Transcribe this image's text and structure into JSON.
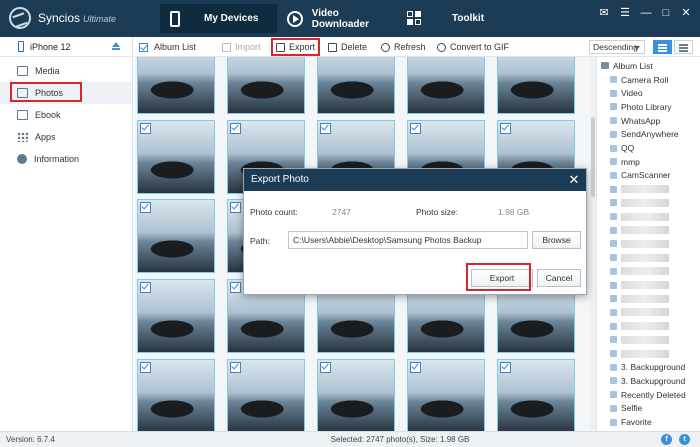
{
  "app": {
    "name": "Syncios",
    "edition": "Ultimate"
  },
  "main_tabs": [
    {
      "label": "My Devices",
      "icon": "phone-icon"
    },
    {
      "label": "Video Downloader",
      "icon": "play-icon"
    },
    {
      "label": "Toolkit",
      "icon": "toolkit-icon"
    }
  ],
  "window_controls": [
    "chat-icon",
    "menu-icon",
    "minimize-icon",
    "maximize-icon",
    "close-icon"
  ],
  "device": {
    "name": "iPhone 12"
  },
  "nav": [
    {
      "label": "Media",
      "icon": "media-icon",
      "active": false
    },
    {
      "label": "Photos",
      "icon": "photos-icon",
      "active": true
    },
    {
      "label": "Ebook",
      "icon": "ebook-icon",
      "active": false
    },
    {
      "label": "Apps",
      "icon": "apps-icon",
      "active": false
    },
    {
      "label": "Information",
      "icon": "info-icon",
      "active": false
    }
  ],
  "toolbar": {
    "album_list": "Album List",
    "import": "Import",
    "export": "Export",
    "delete": "Delete",
    "refresh": "Refresh",
    "convert_gif": "Convert to GIF",
    "sort": "Descending"
  },
  "albums": {
    "header": "Album List",
    "items": [
      "Camera Roll",
      "Video",
      "Photo Library",
      "WhatsApp",
      "SendAnywhere",
      "QQ",
      "mmp",
      "CamScanner",
      "",
      "",
      "",
      "",
      "",
      "",
      "",
      "",
      "",
      "",
      "",
      "",
      "",
      "3. Backupground",
      "3. Backupground",
      "Recently Deleted",
      "Selfie",
      "Favorite"
    ]
  },
  "dialog": {
    "title": "Export Photo",
    "photo_count_label": "Photo count:",
    "photo_count": "2747",
    "photo_size_label": "Photo size:",
    "photo_size": "1.98 GB",
    "path_label": "Path:",
    "path": "C:\\Users\\Abbie\\Desktop\\Samsung Photos Backup",
    "browse": "Browse",
    "export": "Export",
    "cancel": "Cancel"
  },
  "status": {
    "version": "Version: 6.7.4",
    "selection": "Selected: 2747 photo(s), Size: 1.98 GB"
  }
}
